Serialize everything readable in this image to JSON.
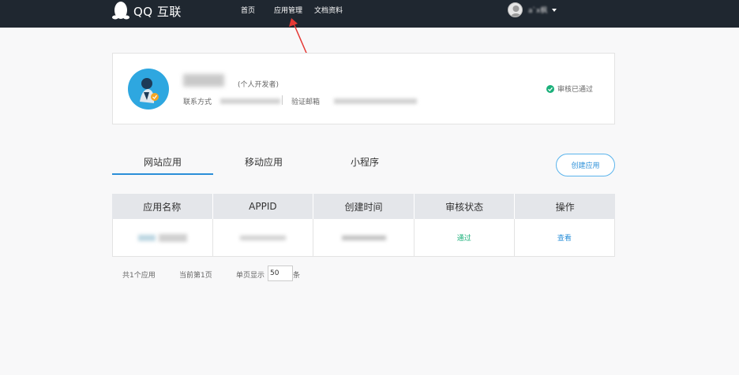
{
  "header": {
    "logo_text": "QQ 互联",
    "nav": [
      "首页",
      "应用管理",
      "文档资料"
    ],
    "user_name": "a`x枫"
  },
  "profile": {
    "dev_type": "(个人开发者)",
    "contact_label": "联系方式",
    "email_label": "验证邮箱",
    "status": "审核已通过"
  },
  "tabs": [
    "网站应用",
    "移动应用",
    "小程序"
  ],
  "create_button": "创建应用",
  "table": {
    "headers": [
      "应用名称",
      "APPID",
      "创建时间",
      "审核状态",
      "操作"
    ],
    "rows": [
      {
        "status": "通过",
        "action": "查看"
      }
    ]
  },
  "pagination": {
    "total": "共1个应用",
    "current": "当前第1页",
    "per_page_label": "单页显示",
    "per_page_value": "50",
    "unit": "条"
  },
  "colors": {
    "topbar": "#1f2730",
    "accent": "#2a8fd8",
    "success": "#1bb07a"
  }
}
